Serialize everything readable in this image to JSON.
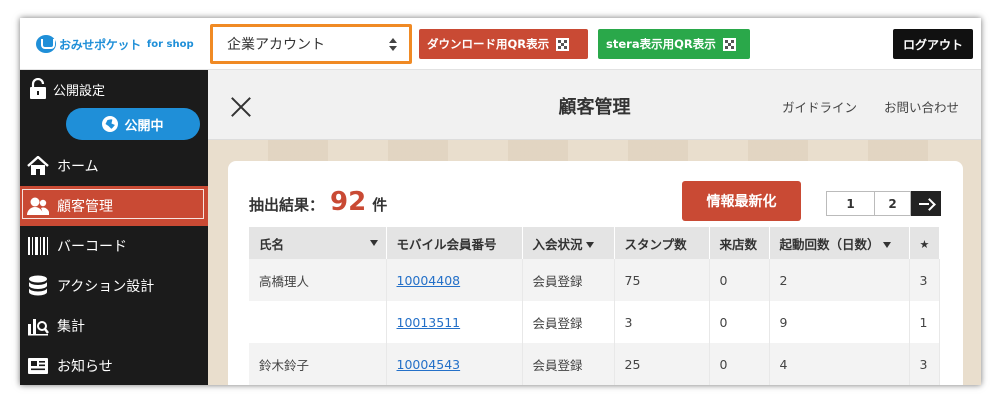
{
  "topbar": {
    "logo_text": "おみせポケット",
    "logo_sub": "for shop",
    "account_select": "企業アカウント",
    "download_qr": "ダウンロード用QR表示",
    "stera_qr": "stera表示用QR表示",
    "logout": "ログアウト"
  },
  "sidebar": {
    "public_setting": "公開設定",
    "public_toggle": "公開中",
    "items": [
      {
        "label": "ホーム",
        "icon": "home-icon"
      },
      {
        "label": "顧客管理",
        "icon": "users-icon",
        "active": true
      },
      {
        "label": "バーコード",
        "icon": "barcode-icon"
      },
      {
        "label": "アクション設計",
        "icon": "database-icon"
      },
      {
        "label": "集計",
        "icon": "analytics-icon"
      },
      {
        "label": "お知らせ",
        "icon": "news-icon"
      }
    ]
  },
  "main": {
    "title": "顧客管理",
    "guide_link": "ガイドライン",
    "contact_link": "お問い合わせ",
    "result_label": "抽出結果：",
    "result_count": "92",
    "result_unit": "件",
    "update_button": "情報最新化",
    "pages": [
      "1",
      "2"
    ],
    "table": {
      "headers": [
        "氏名",
        "モバイル会員番号",
        "入会状況",
        "スタンプ数",
        "来店数",
        "起動回数（日数）",
        "★"
      ],
      "rows": [
        [
          "高橋理人",
          "10004408",
          "会員登録",
          "75",
          "0",
          "2",
          "3"
        ],
        [
          "",
          "10013511",
          "会員登録",
          "3",
          "0",
          "9",
          "1"
        ],
        [
          "鈴木鈴子",
          "10004543",
          "会員登録",
          "25",
          "0",
          "4",
          "3"
        ]
      ]
    }
  },
  "colors": {
    "accent_red": "#c94a34",
    "accent_green": "#2aa84a",
    "accent_blue": "#1f8fd8",
    "highlight_orange": "#f08a24"
  }
}
